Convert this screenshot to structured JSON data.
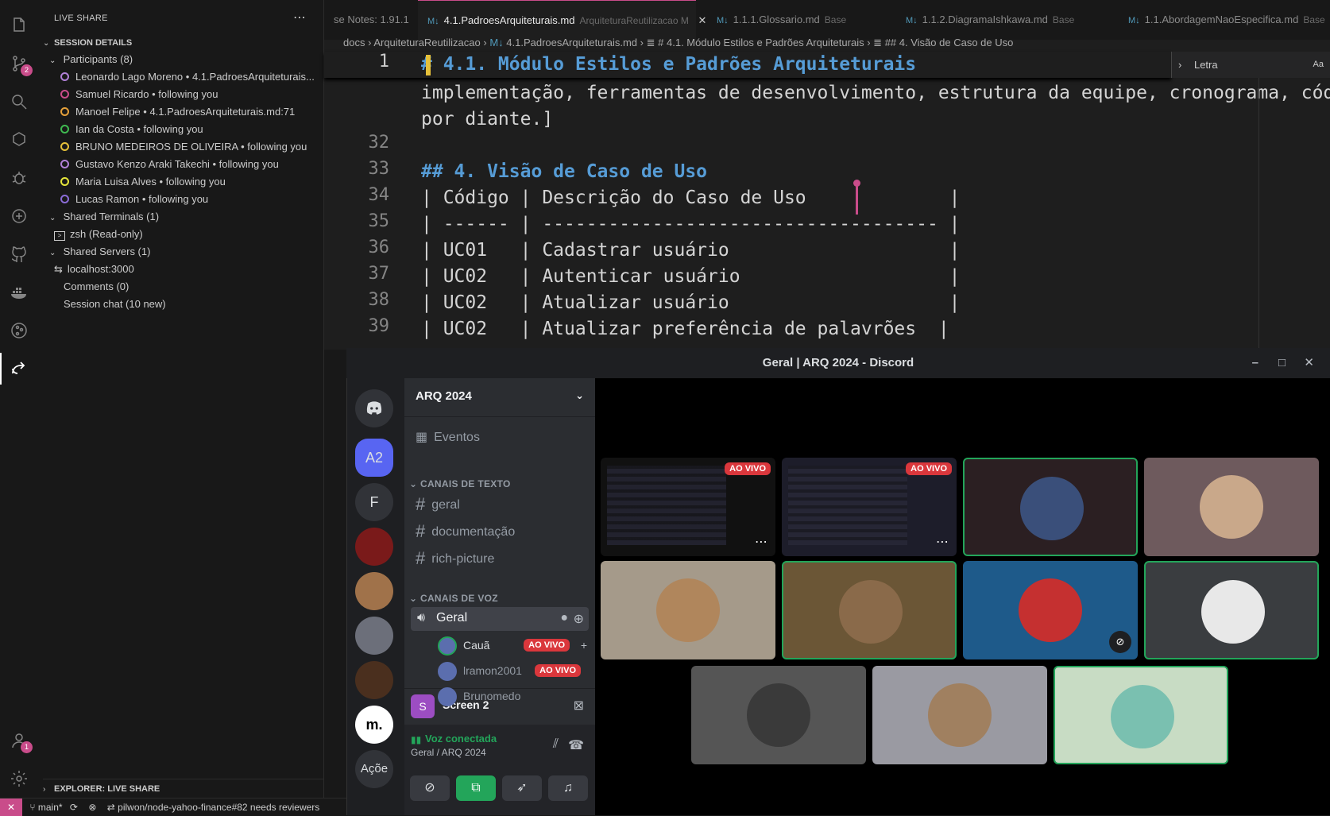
{
  "sidebar": {
    "title": "LIVE SHARE",
    "session_details": "SESSION DETAILS",
    "participants_label": "Participants (8)",
    "participants": [
      {
        "name": "Leonardo Lago Moreno",
        "status": "• 4.1.PadroesArquiteturais...",
        "color": "#b180d7"
      },
      {
        "name": "Samuel Ricardo",
        "status": "• following you",
        "color": "#c94c8a"
      },
      {
        "name": "Manoel Felipe",
        "status": "• 4.1.PadroesArquiteturais.md:71",
        "color": "#e5a03a"
      },
      {
        "name": "Ian da Costa",
        "status": "• following you",
        "color": "#3fb950"
      },
      {
        "name": "BRUNO MEDEIROS DE OLIVEIRA",
        "status": "• following you",
        "color": "#e5c03a"
      },
      {
        "name": "Gustavo Kenzo Araki Takechi",
        "status": "• following you",
        "color": "#b180d7"
      },
      {
        "name": "Maria Luisa Alves",
        "status": "• following you",
        "color": "#e5e53a"
      },
      {
        "name": "Lucas Ramon",
        "status": "• following you",
        "color": "#8b6cd7"
      }
    ],
    "shared_terminals": "Shared Terminals (1)",
    "terminal": "zsh (Read-only)",
    "shared_servers": "Shared Servers (1)",
    "server": "localhost:3000",
    "comments": "Comments (0)",
    "session_chat": "Session chat (10 new)",
    "explorer": "EXPLORER: LIVE SHARE"
  },
  "activity_badges": {
    "source_control": "2",
    "accounts": "1"
  },
  "tabs": [
    {
      "label": "se Notes: 1.91.1",
      "base": ""
    },
    {
      "label": "4.1.PadroesArquiteturais.md",
      "base": "ArquiteturaReutilizacao M"
    },
    {
      "label": "1.1.1.Glossario.md",
      "base": "Base"
    },
    {
      "label": "1.1.2.DiagramaIshkawa.md",
      "base": "Base"
    },
    {
      "label": "1.1.AbordagemNaoEspecifica.md",
      "base": "Base"
    }
  ],
  "breadcrumb": [
    "docs",
    "ArquiteturaReutilizacao",
    "4.1.PadroesArquiteturais.md",
    "# 4.1. Módulo Estilos e Padrões Arquiteturais",
    "## 4. Visão de Caso de Uso"
  ],
  "find_widget": {
    "value": "Letra",
    "match_case": "Aa"
  },
  "code": {
    "sticky_line_no": "1",
    "sticky": "# 4.1. Módulo Estilos e Padrões Arquiteturais",
    "wrap1": "implementação, ferramentas de desenvolvimento, estrutura da equipe, cronograma, código",
    "wrap2": "por diante.]",
    "lines": [
      {
        "no": "32",
        "text": ""
      },
      {
        "no": "33",
        "text": "## 4. Visão de Caso de Uso"
      },
      {
        "no": "34",
        "text": "| Código | Descrição do Caso de Uso             |"
      },
      {
        "no": "35",
        "text": "| ------ | ------------------------------------ |"
      },
      {
        "no": "36",
        "text": "| UC01   | Cadastrar usuário                    |"
      },
      {
        "no": "37",
        "text": "| UC02   | Autenticar usuário                   |"
      },
      {
        "no": "38",
        "text": "| UC02   | Atualizar usuário                    |"
      },
      {
        "no": "39",
        "text": "| UC02   | Atualizar preferência de palavrões  |"
      }
    ]
  },
  "discord": {
    "window_title": "Geral | ARQ 2024 - Discord",
    "server_name": "ARQ 2024",
    "events": "Eventos",
    "text_category": "CANAIS DE TEXTO",
    "text_channels": [
      "geral",
      "documentação",
      "rich-picture"
    ],
    "voice_category": "CANAIS DE VOZ",
    "voice_channel": "Geral",
    "voice_users": [
      {
        "name": "Cauã",
        "live": "AO VIVO"
      },
      {
        "name": "lramon2001",
        "live": "AO VIVO"
      },
      {
        "name": "Brunomedo",
        "live": ""
      }
    ],
    "screen_share": "Screen 2",
    "voice_status": "Voz conectada",
    "voice_location": "Geral / ARQ 2024",
    "guilds": [
      "A2",
      "F",
      "Açõe"
    ],
    "live_badge": "AO VIVO"
  },
  "statusbar": {
    "branch": "main*",
    "pr": "pilwon/node-yahoo-finance#82 needs reviewers"
  }
}
